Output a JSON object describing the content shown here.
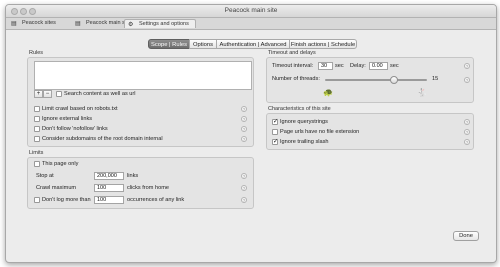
{
  "window": {
    "title": "Peacock main site"
  },
  "browser_tabs": [
    {
      "label": "Peacock sites",
      "icon": "document-icon"
    },
    {
      "label": "Peacock main site",
      "icon": "document-icon"
    },
    {
      "label": "Settings and options",
      "icon": "gear-icon"
    }
  ],
  "segments": [
    {
      "label": "Scope | Rules",
      "selected": true
    },
    {
      "label": "Options",
      "selected": false
    },
    {
      "label": "Authentication | Advanced",
      "selected": false
    },
    {
      "label": "Finish actions | Schedule",
      "selected": false
    }
  ],
  "rules": {
    "group_label": "Rules",
    "add_symbol": "+",
    "remove_symbol": "−",
    "search_content_label": "Search content as well as url",
    "checkboxes": [
      {
        "label": "Limit crawl based on robots.txt",
        "checked": false
      },
      {
        "label": "Ignore external links",
        "checked": false
      },
      {
        "label": "Don't follow 'nofollow' links",
        "checked": false
      },
      {
        "label": "Consider subdomains of the root domain internal",
        "checked": false
      }
    ]
  },
  "limits": {
    "group_label": "Limits",
    "this_page_only": "This page only",
    "stop_at_label": "Stop at",
    "stop_at_value": "200,000",
    "stop_at_unit": "links",
    "crawl_max_label": "Crawl maximum",
    "crawl_max_value": "100",
    "crawl_max_unit": "clicks from home",
    "dont_log_label": "Don't log more than",
    "dont_log_value": "100",
    "dont_log_unit": "occurrences of any link"
  },
  "timeout": {
    "group_label": "Timeout and delays",
    "timeout_label": "Timeout interval:",
    "timeout_value": "30",
    "sec1": "sec",
    "delay_label": "Delay:",
    "delay_value": "0.00",
    "sec2": "sec",
    "threads_label": "Number of threads:",
    "threads_value": "15",
    "threads_fraction": 0.68
  },
  "characteristics": {
    "group_label": "Characteristics of this site",
    "checkboxes": [
      {
        "label": "Ignore querystrings",
        "checked": true
      },
      {
        "label": "Page urls have no file extension",
        "checked": false
      },
      {
        "label": "Ignore trailing slash",
        "checked": true
      }
    ]
  },
  "done_label": "Done",
  "help_symbol": "?"
}
